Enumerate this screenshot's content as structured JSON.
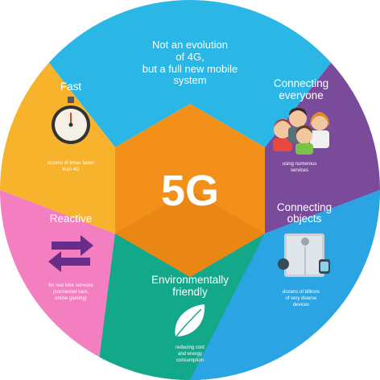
{
  "center": {
    "label": "5G"
  },
  "colors": {
    "top": "#2ab7e6",
    "top_right": "#7b4b9b",
    "bottom_right": "#2aa4e2",
    "bottom": "#14a88a",
    "bottom_left": "#f37ec0",
    "top_left": "#f7b32b",
    "hexagon": "#f39019"
  },
  "segments": {
    "top": {
      "lines": [
        "Not an evolution",
        "of 4G,",
        "but a full new mobile",
        "system"
      ]
    },
    "top_right": {
      "title_lines": [
        "Connecting",
        "everyone"
      ],
      "icon": "people-icon",
      "caption_lines": [
        "using numerous",
        "services"
      ]
    },
    "bottom_right": {
      "title_lines": [
        "Connecting",
        "objects"
      ],
      "icon": "devices-icon",
      "caption_lines": [
        "dozens of billions",
        "of very diverse",
        "devices"
      ]
    },
    "bottom": {
      "title_lines": [
        "Environmentally",
        "friendly"
      ],
      "icon": "leaf-icon",
      "caption_lines": [
        "reducing cost",
        "and energy",
        "consumption"
      ]
    },
    "bottom_left": {
      "title": "Reactive",
      "icon": "arrows-icon",
      "caption_lines": [
        "for real time services",
        "(connected cars,",
        "online gaming)"
      ]
    },
    "top_left": {
      "title": "Fast",
      "icon": "stopwatch-icon",
      "caption_lines": [
        "dozens of times faster",
        "than 4G"
      ]
    }
  }
}
